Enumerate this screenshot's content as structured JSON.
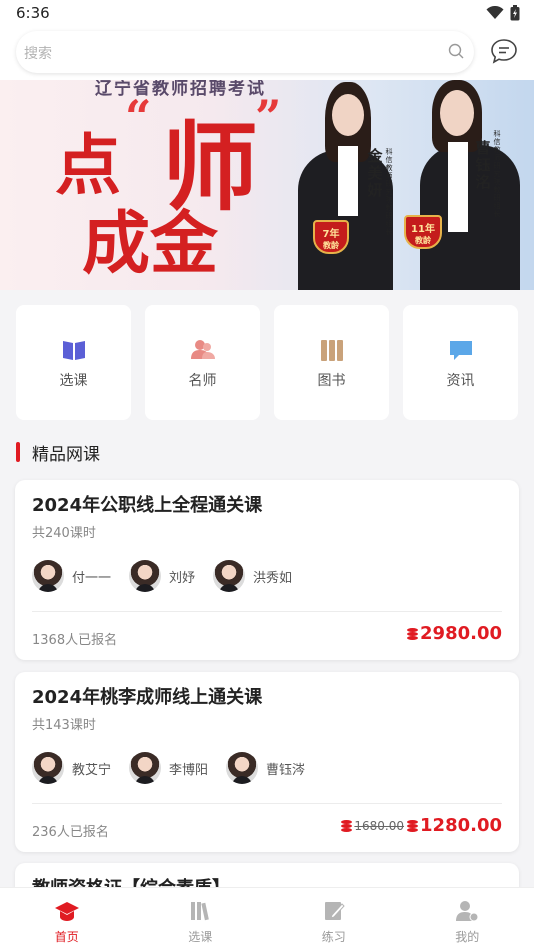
{
  "status_bar": {
    "time": "6:36",
    "wifi_icon": "wifi-icon",
    "battery_icon": "battery-charging-icon"
  },
  "search": {
    "placeholder": "搜索",
    "icon": "search-icon",
    "message_icon": "message-icon"
  },
  "banner": {
    "top_text": "辽宁省教师招聘考试",
    "headline_1": "点",
    "headline_2": "师",
    "headline_3": "成金",
    "teachers": [
      {
        "name": "金美妍",
        "title": "科信教师研究院教研组长",
        "badge_years": "7年",
        "badge_label": "教龄"
      },
      {
        "name": "曹钰洺",
        "title": "科信教师研究院教研组长",
        "badge_years": "11年",
        "badge_label": "教龄"
      }
    ]
  },
  "quick_nav": [
    {
      "label": "选课",
      "icon": "book-open-icon",
      "color": "#5b5fd6"
    },
    {
      "label": "名师",
      "icon": "teachers-icon",
      "color": "#e88a84"
    },
    {
      "label": "图书",
      "icon": "books-icon",
      "color": "#c9a27a"
    },
    {
      "label": "资讯",
      "icon": "chat-bubble-icon",
      "color": "#5ba7e8"
    }
  ],
  "section": {
    "title": "精品网课"
  },
  "courses": [
    {
      "title": "2024年公职线上全程通关课",
      "hours": "共240课时",
      "teachers": [
        "付一一",
        "刘妤",
        "洪秀如"
      ],
      "enrolled": "1368人已报名",
      "price": "2980.00",
      "old_price": ""
    },
    {
      "title": "2024年桃李成师线上通关课",
      "hours": "共143课时",
      "teachers": [
        "教艾宁",
        "李博阳",
        "曹钰涔"
      ],
      "enrolled": "236人已报名",
      "price": "1280.00",
      "old_price": "1680.00"
    },
    {
      "title": "教师资格证【综合素质】",
      "hours": "",
      "teachers": [],
      "enrolled": "",
      "price": "",
      "old_price": ""
    }
  ],
  "bottom_nav": [
    {
      "label": "首页",
      "icon": "graduation-cap-icon",
      "active": true
    },
    {
      "label": "选课",
      "icon": "books-icon",
      "active": false
    },
    {
      "label": "练习",
      "icon": "edit-icon",
      "active": false
    },
    {
      "label": "我的",
      "icon": "user-icon",
      "active": false
    }
  ],
  "colors": {
    "accent": "#e01b22",
    "background": "#f4f4f6"
  }
}
